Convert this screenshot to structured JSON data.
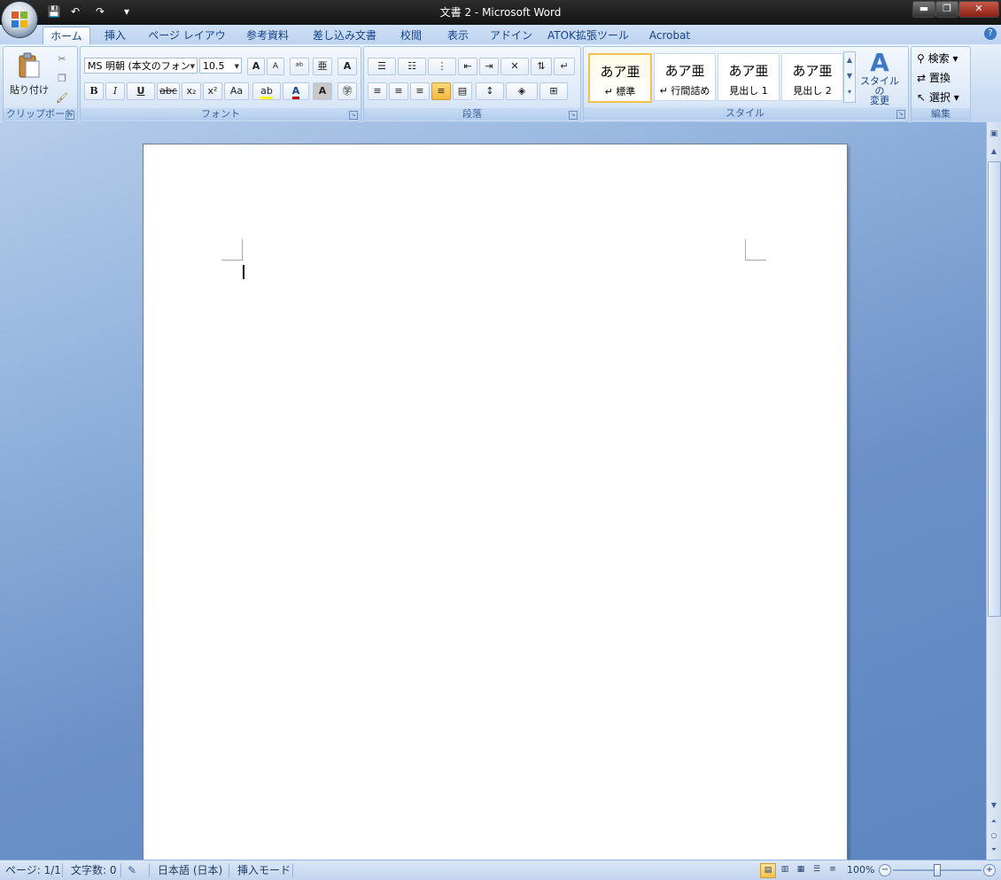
{
  "window": {
    "title": "文書 2 - Microsoft Word",
    "minimize": "▬",
    "restore": "❐",
    "close": "✕"
  },
  "qat": {
    "save_icon": "💾",
    "undo_icon": "↶",
    "redo_icon": "↷",
    "customize_icon": "▾"
  },
  "tabs": [
    {
      "label": "ホーム",
      "active": true
    },
    {
      "label": "挿入"
    },
    {
      "label": "ページ レイアウト"
    },
    {
      "label": "参考資料"
    },
    {
      "label": "差し込み文書"
    },
    {
      "label": "校閲"
    },
    {
      "label": "表示"
    },
    {
      "label": "アドイン"
    },
    {
      "label": "ATOK拡張ツール"
    },
    {
      "label": "Acrobat"
    }
  ],
  "help_icon": "?",
  "clipboard": {
    "paste_label": "貼り付け",
    "group_label": "クリップボード"
  },
  "font": {
    "font_name": "MS 明朝 (本文のフォン",
    "font_size": "10.5",
    "bold": "B",
    "italic": "I",
    "underline": "U",
    "strike": "abc",
    "subscript": "x₂",
    "superscript": "x²",
    "case": "Aa",
    "grow": "A",
    "shrink": "A",
    "group_label": "フォント"
  },
  "paragraph": {
    "group_label": "段落"
  },
  "styles": {
    "items": [
      {
        "preview": "あア亜",
        "name": "↵ 標準",
        "selected": true
      },
      {
        "preview": "あア亜",
        "name": "↵ 行間詰め"
      },
      {
        "preview": "あア亜",
        "name": "見出し 1"
      },
      {
        "preview": "あア亜",
        "name": "見出し 2"
      }
    ],
    "change_styles_line1": "スタイルの",
    "change_styles_line2": "変更",
    "group_label": "スタイル"
  },
  "editing": {
    "find": "検索",
    "replace": "置換",
    "select": "選択",
    "group_label": "編集"
  },
  "statusbar": {
    "page": "ページ: 1/1",
    "word_count": "文字数: 0",
    "language": "日本語 (日本)",
    "mode": "挿入モード",
    "zoom": "100%"
  },
  "colors": {
    "accent": "#15428b",
    "selected_style_border": "#f3c24e",
    "highlight": "#ffff00",
    "font_color": "#c00000"
  }
}
